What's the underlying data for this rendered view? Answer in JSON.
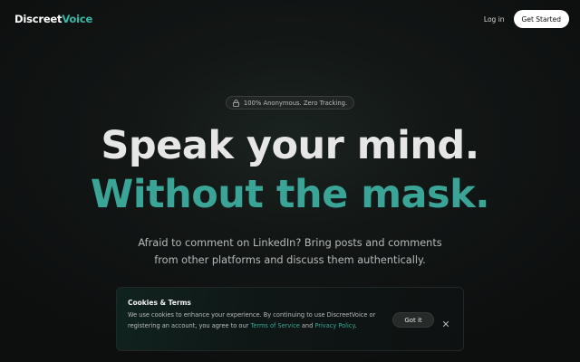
{
  "nav": {
    "brand_part1": "Discreet",
    "brand_part2": "Voice",
    "login_label": "Log in",
    "get_started_label": "Get Started"
  },
  "hero": {
    "badge_text": "100% Anonymous. Zero Tracking.",
    "badge_icon": "lock-icon",
    "headline_line1": "Speak your mind.",
    "headline_line2": "Without the mask.",
    "subtitle_line1": "Afraid to comment on LinkedIn? Bring posts and comments",
    "subtitle_line2": "from other platforms and discuss them authentically."
  },
  "cookie_banner": {
    "title": "Cookies & Terms",
    "text_part1": "We use cookies to enhance your experience. By continuing to use DiscreetVoice or registering an account, you agree to our ",
    "terms_link": "Terms of Service",
    "text_part2": " and ",
    "privacy_link": "Privacy Policy",
    "text_part3": ".",
    "accept_label": "Got it",
    "close_icon": "close-icon"
  },
  "colors": {
    "accent": "#3aa596",
    "background": "#0d0f0f",
    "headline": "#e6e6e6"
  }
}
